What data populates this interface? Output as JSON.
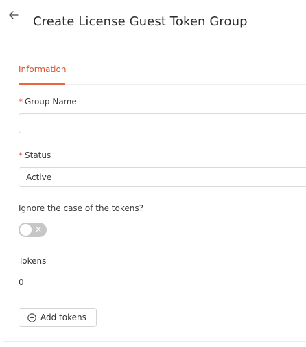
{
  "header": {
    "back_icon": "arrow-left-icon",
    "title": "Create License Guest Token Group"
  },
  "tabs": [
    {
      "label": "Information",
      "active": true
    }
  ],
  "form": {
    "required_mark": "*",
    "group_name": {
      "label": "Group Name",
      "value": ""
    },
    "status": {
      "label": "Status",
      "value": "Active"
    },
    "ignore_case": {
      "label": "Ignore the case of the tokens?",
      "enabled": false,
      "off_glyph": "✕"
    },
    "tokens": {
      "label": "Tokens",
      "count": "0"
    },
    "add_tokens_button": {
      "label": "Add tokens",
      "icon": "plus-circle-icon"
    }
  },
  "colors": {
    "accent": "#e8663e",
    "required": "#e8473b",
    "toggle_off": "#c7c7c7"
  }
}
